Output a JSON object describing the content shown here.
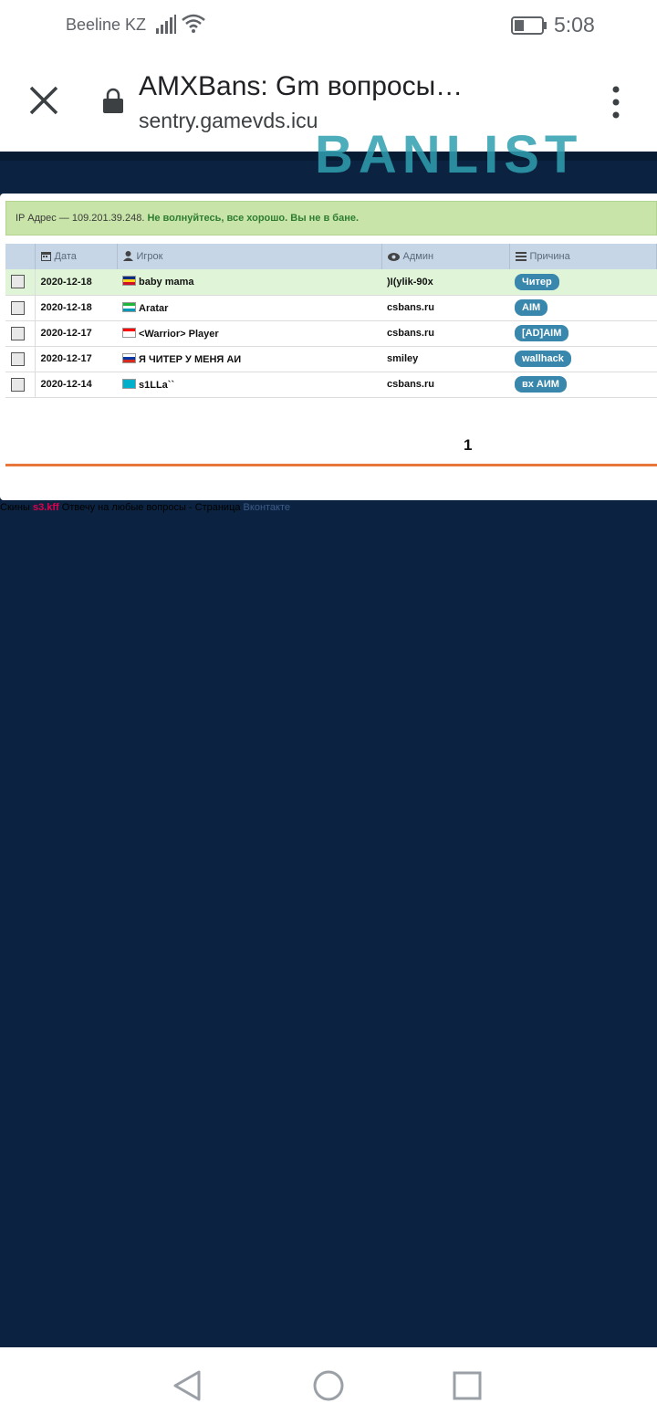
{
  "status_bar": {
    "carrier": "Beeline KZ",
    "time": "5:08"
  },
  "browser": {
    "title": "AMXBans: Gm вопросы…",
    "url": "sentry.gamevds.icu"
  },
  "page": {
    "banner_text": "BANLIST",
    "alert": {
      "ip_text": "IP Адрес — 109.201.39.248.",
      "status_text": "Не волнуйтесь, все хорошо. Вы не в бане."
    },
    "table": {
      "headers": {
        "date": "Дата",
        "player": "Игрок",
        "admin": "Админ",
        "reason": "Причина"
      },
      "rows": [
        {
          "date": "2020-12-18",
          "player": "baby mama",
          "admin": ")I(ylik-90x",
          "reason": "Читер",
          "flag_colors": [
            "#002b7f",
            "#fcd116",
            "#ce1126"
          ]
        },
        {
          "date": "2020-12-18",
          "player": "Aratar",
          "admin": "csbans.ru",
          "reason": "AIM",
          "flag_colors": [
            "#1eb53a",
            "#ffffff",
            "#0099b5"
          ]
        },
        {
          "date": "2020-12-17",
          "player": "<Warrior> Player",
          "admin": "csbans.ru",
          "reason": "[AD]AIM",
          "flag_colors": [
            "#ff0000",
            "#ffffff",
            "#ffffff"
          ]
        },
        {
          "date": "2020-12-17",
          "player": "Я ЧИТЕР У МЕНЯ АИ",
          "admin": "smiley",
          "reason": "wallhack",
          "flag_colors": [
            "#ffffff",
            "#0039a6",
            "#d52b1e"
          ]
        },
        {
          "date": "2020-12-14",
          "player": "s1LLa``",
          "admin": "csbans.ru",
          "reason": "вх АИМ",
          "flag_colors": [
            "#00afca",
            "#00afca",
            "#00afca"
          ]
        }
      ]
    },
    "pagination": {
      "current": "1"
    },
    "footer": {
      "prefix": "Скины",
      "nick": "s3.kff",
      "middle": "Отвечу на любые вопросы - Страница",
      "link": "Вконтакте"
    }
  },
  "colors": {
    "page_background": "#0b2340",
    "badge": "#3a87ad",
    "alert_background": "#c8e4a8",
    "accent_line": "#e8763a"
  }
}
